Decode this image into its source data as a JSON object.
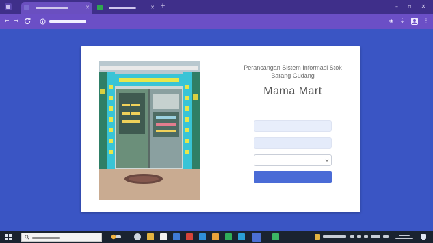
{
  "browser": {
    "tabs": [
      {
        "label": "",
        "favicon_color": "#7b6bd0"
      },
      {
        "label": "",
        "favicon_color": "#2fa84f"
      }
    ]
  },
  "login": {
    "app_title": "Perancangan Sistem Informasi Stok Barang Gudang",
    "brand": "Mama Mart",
    "username_value": "",
    "password_value": "",
    "role_select_value": "",
    "submit_label": ""
  },
  "taskbar": {
    "search_placeholder": ""
  },
  "colors": {
    "page_background": "#3a55c4",
    "tab_strip": "#3f2f8a",
    "toolbar": "#6b4fc6",
    "card": "#ffffff",
    "input_fill": "#e8eefb",
    "primary_button": "#4a6bd6",
    "taskbar": "#1a2330"
  },
  "icons": [
    "browser-menu-icon",
    "close-tab-icon",
    "new-tab-icon",
    "back-icon",
    "forward-icon",
    "reload-icon",
    "site-info-icon",
    "extensions-icon",
    "profile-icon",
    "more-icon",
    "windows-start-icon",
    "search-icon",
    "task-view-icon",
    "file-explorer-icon",
    "chrome-icon",
    "chevron-down-icon"
  ]
}
